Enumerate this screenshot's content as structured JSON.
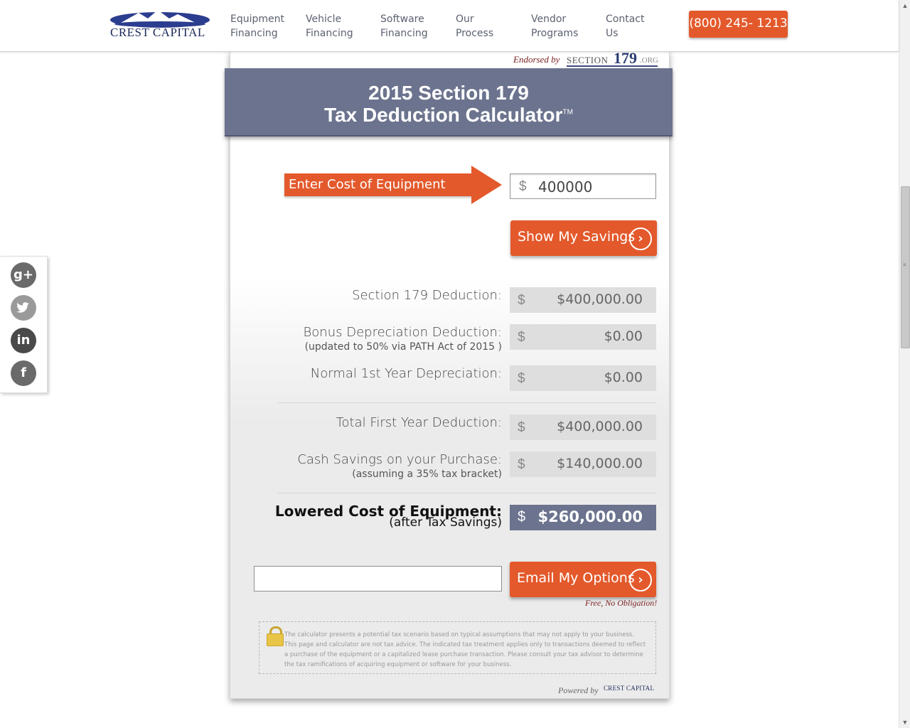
{
  "header": {
    "logo_text": "CREST CAPITAL",
    "nav": [
      {
        "line1": "Equipment",
        "line2": "Financing"
      },
      {
        "line1": "Vehicle",
        "line2": "Financing"
      },
      {
        "line1": "Software",
        "line2": "Financing"
      },
      {
        "line1": "Our",
        "line2": "Process"
      },
      {
        "line1": "Vendor",
        "line2": "Programs"
      },
      {
        "line1": "Contact",
        "line2": "Us"
      }
    ],
    "phone": "(800) 245- 1213"
  },
  "endorsement": {
    "label": "Endorsed by",
    "logo_prefix": "SECTION",
    "logo_number": "179",
    "logo_suffix": ".ORG"
  },
  "calculator": {
    "title_line1": "2015 Section 179",
    "title_line2": "Tax Deduction Calculator",
    "trademark": "TM",
    "arrow_label": "Enter Cost of Equipment Here",
    "currency_symbol": "$",
    "cost_value": "400000",
    "show_button": "Show My Savings",
    "rows": [
      {
        "label": "Section 179 Deduction:",
        "sub": "",
        "value": "$400,000.00"
      },
      {
        "label": "Bonus Depreciation Deduction:",
        "sub": "(updated to 50% via PATH Act of 2015 )",
        "value": "$0.00"
      },
      {
        "label": "Normal 1st Year Depreciation:",
        "sub": "",
        "value": "$0.00"
      },
      {
        "label": "Total First Year Deduction:",
        "sub": "",
        "value": "$400,000.00"
      },
      {
        "label": "Cash Savings on your Purchase:",
        "sub": "(assuming a 35% tax bracket)",
        "value": "$140,000.00"
      }
    ],
    "lowered": {
      "label": "Lowered Cost of Equipment:",
      "sub": "(after Tax Savings)",
      "value": "$260,000.00"
    },
    "email_value": "",
    "email_button": "Email My Options",
    "free_text": "Free, No Obligation!",
    "disclaimer": "The calculator presents a potential tax scenario based on typical assumptions that may not apply to your business. This page and calculator are not tax advice. The indicated tax treatment applies only to transactions deemed to reflect a purchase of the equipment or a capitalized lease purchase transaction. Please consult your tax advisor to determine the tax ramifications of acquiring equipment or software for your business.",
    "powered_by": "Powered by",
    "powered_logo": "CREST CAPITAL"
  },
  "social": [
    {
      "icon": "google-plus-icon",
      "glyph": "g+"
    },
    {
      "icon": "twitter-icon",
      "glyph": "t"
    },
    {
      "icon": "linkedin-icon",
      "glyph": "in"
    },
    {
      "icon": "facebook-icon",
      "glyph": "f"
    }
  ],
  "colors": {
    "accent_orange": "#e3592b",
    "title_slate": "#6b738e",
    "brand_navy": "#1d2a5c"
  }
}
